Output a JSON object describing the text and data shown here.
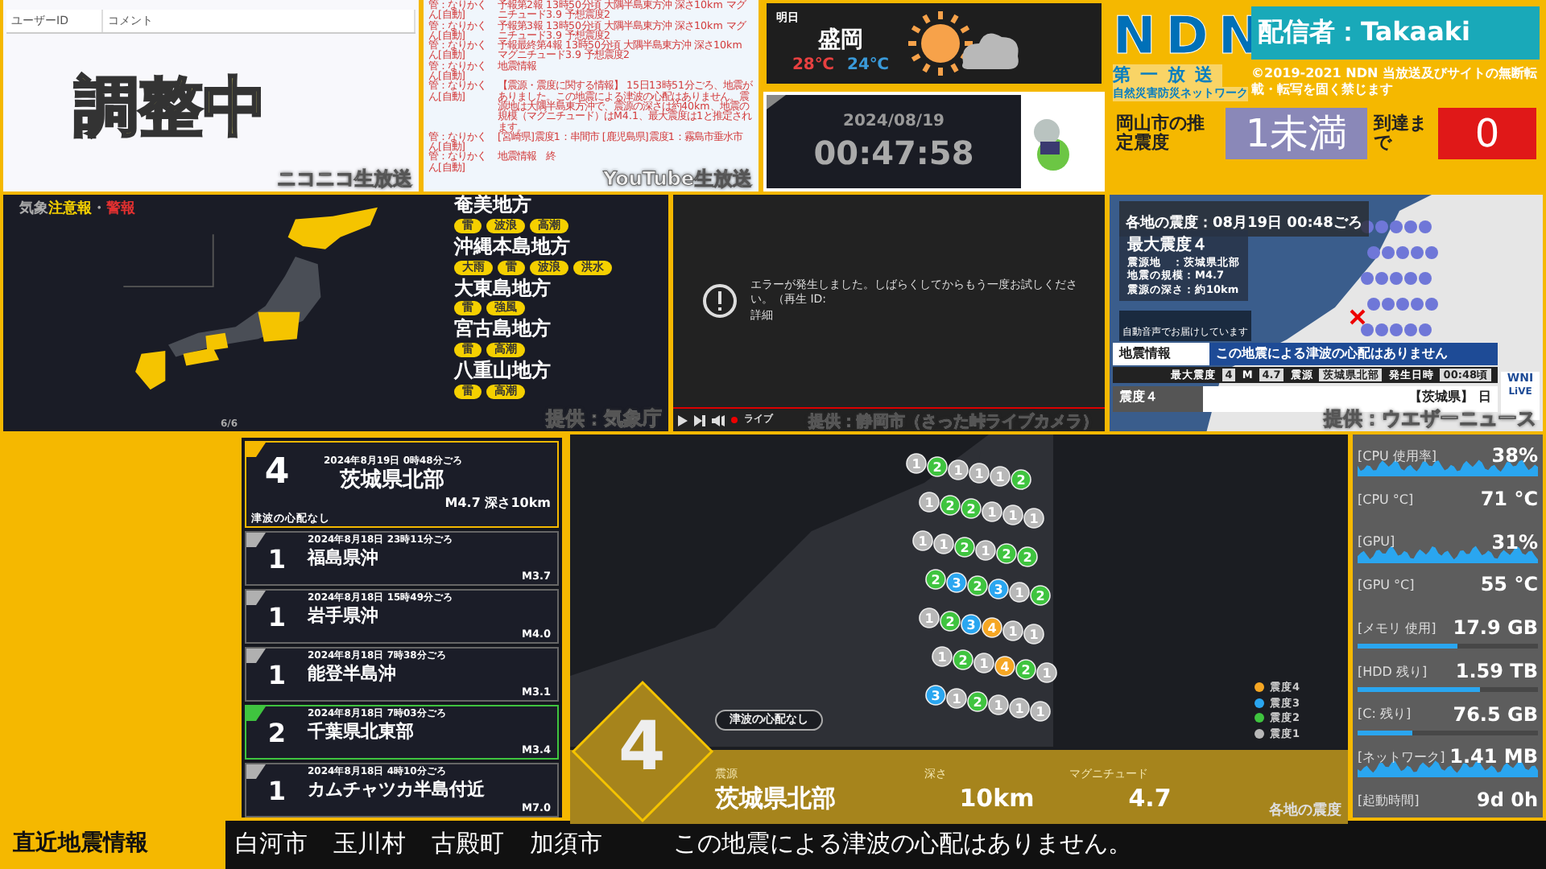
{
  "comment_viewer": {
    "columns": [
      "ユーザーID",
      "コメント"
    ],
    "status": "調整中",
    "caption": "ニコニコ生放送"
  },
  "comment_log": {
    "rows": [
      {
        "user": "管：なりかくん[自動]",
        "text": "予報第2報 13時50分頃 大隅半島東方沖 深さ10km マグニチュード3.9 予想震度2"
      },
      {
        "user": "管：なりかくん[自動]",
        "text": "予報第3報 13時50分頃 大隅半島東方沖 深さ10km マグニチュード3.9 予想震度2"
      },
      {
        "user": "管：なりかくん[自動]",
        "text": "予報最終第4報 13時50分頃 大隅半島東方沖 深さ10km マグニチュード3.9 予想震度2"
      },
      {
        "user": "管：なりかくん[自動]",
        "text": "地震情報"
      },
      {
        "user": "管：なりかくん[自動]",
        "text": "【震源・震度に関する情報】 15日13時51分ごろ、地震がありました。この地震による津波の心配はありません。震源地は大隅半島東方沖で、震源の深さは約40km、地震の規模（マグニチュード）はM4.1、最大震度は1と推定されます。"
      },
      {
        "user": "管：なりかくん[自動]",
        "text": "[宮崎県]震度1：串間市 [鹿児島県]震度1：霧島市垂水市"
      },
      {
        "user": "管：なりかくん[自動]",
        "text": "地震情報　終"
      }
    ],
    "caption": "YouTube生放送"
  },
  "weather": {
    "day": "明日",
    "city": "盛岡",
    "high": "28℃",
    "low": "24℃"
  },
  "clock": {
    "date": "2024/08/19",
    "time": "00:47:58"
  },
  "broadcaster": {
    "logo": "NDN",
    "station": "第一放送",
    "network": "自然災害防災ネットワーク",
    "streamer": "配信者：Takaaki",
    "copyright": "©2019-2021 NDN 当放送及びサイトの無断転載・転写を固く禁じます",
    "intensity_label": "岡山市の推定震度",
    "intensity": "1未満",
    "arrival_label": "到達まで",
    "arrival": "0"
  },
  "warnings": {
    "title": [
      {
        "text": "気象",
        "kind": "plain"
      },
      {
        "text": "注意報",
        "kind": "advisory"
      },
      {
        "text": "・",
        "kind": "plain"
      },
      {
        "text": "警報",
        "kind": "warning"
      }
    ],
    "regions": [
      {
        "name": "奄美地方",
        "tags": [
          "雷",
          "波浪",
          "高潮"
        ]
      },
      {
        "name": "沖縄本島地方",
        "tags": [
          "大雨",
          "雷",
          "波浪",
          "洪水"
        ]
      },
      {
        "name": "大東島地方",
        "tags": [
          "雷",
          "強風"
        ]
      },
      {
        "name": "宮古島地方",
        "tags": [
          "雷",
          "高潮"
        ]
      },
      {
        "name": "八重山地方",
        "tags": [
          "雷",
          "高潮"
        ]
      }
    ],
    "page": "6/6",
    "caption": "提供：気象庁"
  },
  "video": {
    "error": "エラーが発生しました。しばらくしてからもう一度お試しください。（再生 ID:",
    "detail": "詳細",
    "live": "ライブ",
    "caption": "提供：静岡市（さった峠ライブカメラ）"
  },
  "shake_map": {
    "header": "各地の震度：08月19日 00:48ごろ",
    "max": "最大震度４",
    "details": [
      "震源地　：茨城県北部",
      "地震の規模：M4.7",
      "震源の深さ：約10km"
    ],
    "voice": "自動音声でお届けしています",
    "label": "地震情報",
    "message": "この地震による津波の心配はありません",
    "summary": [
      {
        "label": "最大震度",
        "value": "4"
      },
      {
        "label": "M",
        "value": "4.7"
      },
      {
        "label": "震源",
        "value": "茨城県北部"
      },
      {
        "label": "発生日時",
        "value": "00:48頃"
      }
    ],
    "scale": "震度４",
    "area": "【茨城県】 日",
    "logo": "WNI",
    "live": "LiVE",
    "caption": "提供：ウエザーニュース"
  },
  "quakes": [
    {
      "kind": "featured",
      "intensity": "4",
      "time": "2024年8月19日 0時48分ごろ",
      "place": "茨城県北部",
      "note": "津波の心配なし",
      "detail": "M4.7 深さ10km",
      "color": "#f5b800"
    },
    {
      "kind": "compact",
      "intensity": "1",
      "time": "2024年8月18日 23時11分ごろ",
      "place": "福島県沖",
      "detail": "M3.7",
      "color": "#b0b0b0"
    },
    {
      "kind": "compact",
      "intensity": "1",
      "time": "2024年8月18日 15時49分ごろ",
      "place": "岩手県沖",
      "detail": "M4.0",
      "color": "#b0b0b0"
    },
    {
      "kind": "compact",
      "intensity": "1",
      "time": "2024年8月18日 7時38分ごろ",
      "place": "能登半島沖",
      "detail": "M3.1",
      "color": "#b0b0b0"
    },
    {
      "kind": "compact",
      "intensity": "2",
      "time": "2024年8月18日 7時03分ごろ",
      "place": "千葉県北東部",
      "detail": "M3.4",
      "color": "#3fc43f"
    },
    {
      "kind": "compact",
      "intensity": "1",
      "time": "2024年8月18日 4時10分ごろ",
      "place": "カムチャツカ半島付近",
      "detail": "M7.0",
      "color": "#b0b0b0"
    }
  ],
  "quake_map": {
    "stations": [
      {
        "label": "1",
        "color": "#b8b8b8"
      },
      {
        "label": "2",
        "color": "#3fc43f"
      },
      {
        "label": "1",
        "color": "#b8b8b8"
      },
      {
        "label": "1",
        "color": "#b8b8b8"
      },
      {
        "label": "1",
        "color": "#b8b8b8"
      },
      {
        "label": "2",
        "color": "#3fc43f"
      },
      {
        "label": "1",
        "color": "#b8b8b8"
      },
      {
        "label": "2",
        "color": "#3fc43f"
      },
      {
        "label": "2",
        "color": "#3fc43f"
      },
      {
        "label": "1",
        "color": "#b8b8b8"
      },
      {
        "label": "1",
        "color": "#b8b8b8"
      },
      {
        "label": "1",
        "color": "#b8b8b8"
      },
      {
        "label": "1",
        "color": "#b8b8b8"
      },
      {
        "label": "1",
        "color": "#b8b8b8"
      },
      {
        "label": "2",
        "color": "#3fc43f"
      },
      {
        "label": "1",
        "color": "#b8b8b8"
      },
      {
        "label": "2",
        "color": "#3fc43f"
      },
      {
        "label": "2",
        "color": "#3fc43f"
      },
      {
        "label": "2",
        "color": "#3fc43f"
      },
      {
        "label": "3",
        "color": "#2aa6f0"
      },
      {
        "label": "2",
        "color": "#3fc43f"
      },
      {
        "label": "3",
        "color": "#2aa6f0"
      },
      {
        "label": "1",
        "color": "#b8b8b8"
      },
      {
        "label": "2",
        "color": "#3fc43f"
      },
      {
        "label": "1",
        "color": "#b8b8b8"
      },
      {
        "label": "2",
        "color": "#3fc43f"
      },
      {
        "label": "3",
        "color": "#2aa6f0"
      },
      {
        "label": "4",
        "color": "#f5a623"
      },
      {
        "label": "1",
        "color": "#b8b8b8"
      },
      {
        "label": "1",
        "color": "#b8b8b8"
      },
      {
        "label": "1",
        "color": "#b8b8b8"
      },
      {
        "label": "2",
        "color": "#3fc43f"
      },
      {
        "label": "1",
        "color": "#b8b8b8"
      },
      {
        "label": "4",
        "color": "#f5a623"
      },
      {
        "label": "2",
        "color": "#3fc43f"
      },
      {
        "label": "1",
        "color": "#b8b8b8"
      },
      {
        "label": "3",
        "color": "#2aa6f0"
      },
      {
        "label": "1",
        "color": "#b8b8b8"
      },
      {
        "label": "2",
        "color": "#3fc43f"
      },
      {
        "label": "1",
        "color": "#b8b8b8"
      },
      {
        "label": "1",
        "color": "#b8b8b8"
      },
      {
        "label": "1",
        "color": "#b8b8b8"
      }
    ],
    "legend": [
      {
        "label": "震度4",
        "color": "#f5a623"
      },
      {
        "label": "震度3",
        "color": "#2aa6f0"
      },
      {
        "label": "震度2",
        "color": "#3fc43f"
      },
      {
        "label": "震度1",
        "color": "#b8b8b8"
      }
    ],
    "intensity": "4",
    "tsunami": "津波の心配なし",
    "fields": [
      {
        "label": "震源",
        "value": "茨城県北部"
      },
      {
        "label": "深さ",
        "value": "10km"
      },
      {
        "label": "マグニチュード",
        "value": "4.7"
      }
    ],
    "caption": "各地の震度"
  },
  "system": [
    {
      "kind": "graph",
      "label": "[CPU 使用率]",
      "value": "38%"
    },
    {
      "kind": "plain",
      "label": "[CPU °C]",
      "value": "71 °C"
    },
    {
      "kind": "graph",
      "label": "[GPU]",
      "value": "31%"
    },
    {
      "kind": "plain",
      "label": "[GPU °C]",
      "value": "55 °C"
    },
    {
      "kind": "bar",
      "label": "[メモリ 使用]",
      "value": "17.9 GB",
      "level": 0.55
    },
    {
      "kind": "bar",
      "label": "[HDD 残り]",
      "value": "1.59 TB",
      "level": 0.68
    },
    {
      "kind": "bar",
      "label": "[C: 残り]",
      "value": "76.5 GB",
      "level": 0.3
    },
    {
      "kind": "graph",
      "label": "[ネットワーク]",
      "value": "1.41 MB"
    },
    {
      "kind": "plain",
      "label": "[起動時間]",
      "value": "9d 0h"
    }
  ],
  "ticker": {
    "title": "直近地震情報",
    "places": [
      "白河市",
      "玉川村",
      "古殿町",
      "加須市"
    ],
    "message": "この地震による津波の心配はありません。"
  }
}
